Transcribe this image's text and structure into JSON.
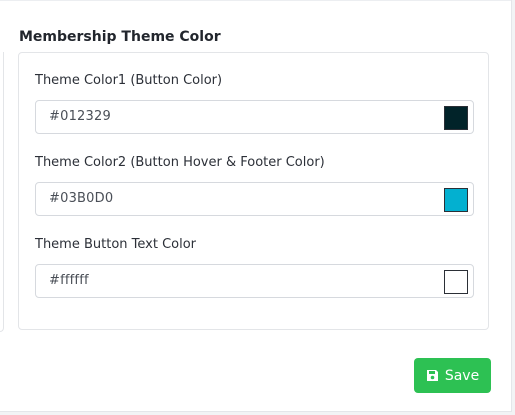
{
  "section": {
    "title": "Membership Theme Color"
  },
  "fields": [
    {
      "label": "Theme Color1 (Button Color)",
      "value": "#012329",
      "swatch": "#012329"
    },
    {
      "label": "Theme Color2 (Button Hover & Footer Color)",
      "value": "#03B0D0",
      "swatch": "#03B0D0"
    },
    {
      "label": "Theme Button Text Color",
      "value": "#ffffff",
      "swatch": "#ffffff"
    }
  ],
  "actions": {
    "save_label": "Save",
    "save_icon": "floppy-disk-icon",
    "save_color": "#2dc153"
  }
}
